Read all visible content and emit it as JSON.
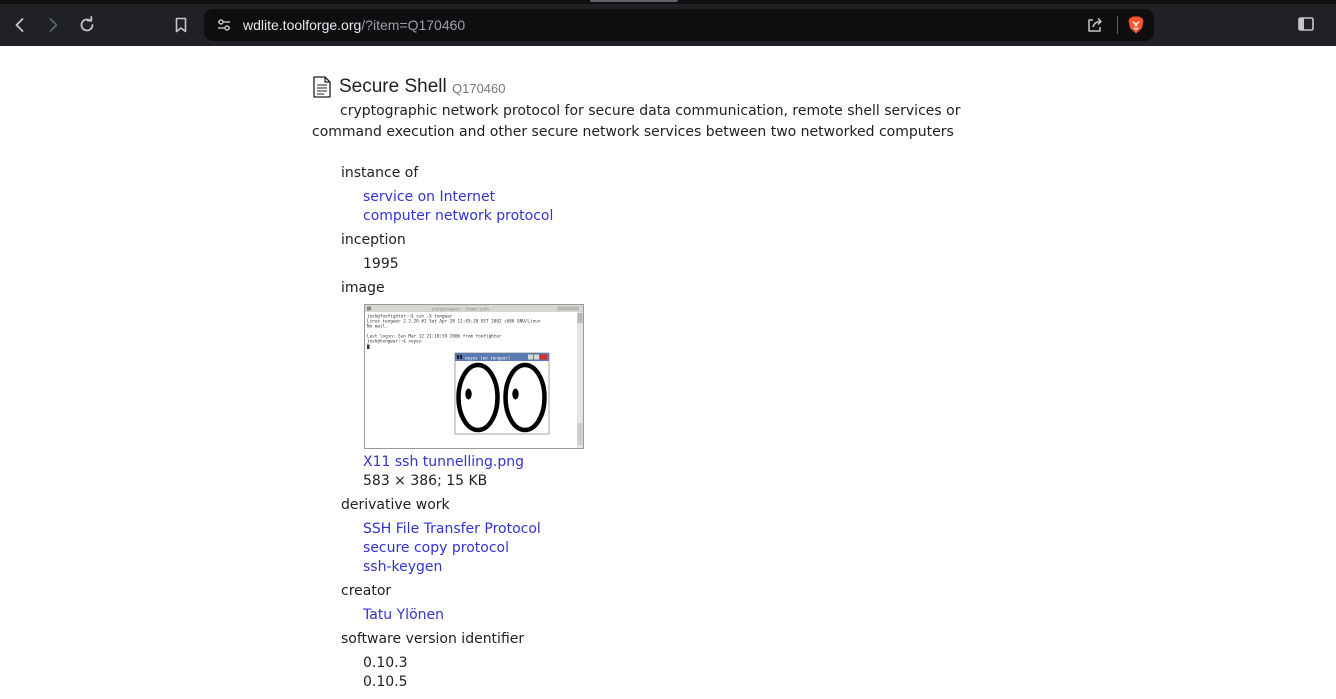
{
  "browser": {
    "url_host": "wdlite.toolforge.org",
    "url_path": "/?item=Q170460"
  },
  "item": {
    "title": "Secure Shell",
    "qid": "Q170460",
    "description": "cryptographic network protocol for secure data communication, remote shell services or command execution and other secure network services between two networked computers"
  },
  "statements": {
    "instance_of": {
      "label": "instance of",
      "values": [
        "service on Internet",
        "computer network protocol"
      ]
    },
    "inception": {
      "label": "inception",
      "values": [
        "1995"
      ]
    },
    "image": {
      "label": "image",
      "file_name": "X11 ssh tunnelling.png",
      "file_info": "583 × 386; 15 KB",
      "thumb_text": {
        "window_title": "josh@tengwar: /home/josh",
        "xeyes_title": "xeyes (on tengwar)",
        "lines": [
          "josh@foofighter:~$ ssh -X tengwar",
          "Linux tengwar 2.2.20 #1 Sat Apr 20 11:45:28 EST 2002 i686 GNU/Linux",
          "No mail.",
          "",
          "Last login: Sun Mar 12 21:10:59 2006 from foofighter",
          "josh@tengwar:~$ xeyes"
        ]
      }
    },
    "derivative_work": {
      "label": "derivative work",
      "values": [
        "SSH File Transfer Protocol",
        "secure copy protocol",
        "ssh-keygen"
      ]
    },
    "creator": {
      "label": "creator",
      "values": [
        "Tatu Ylönen"
      ]
    },
    "software_version": {
      "label": "software version identifier",
      "values": [
        "0.10.3",
        "0.10.5"
      ]
    }
  },
  "colors": {
    "link": "#3333cc",
    "text": "#202122",
    "chrome_bg": "#202124",
    "brave_orange": "#fb542b"
  }
}
